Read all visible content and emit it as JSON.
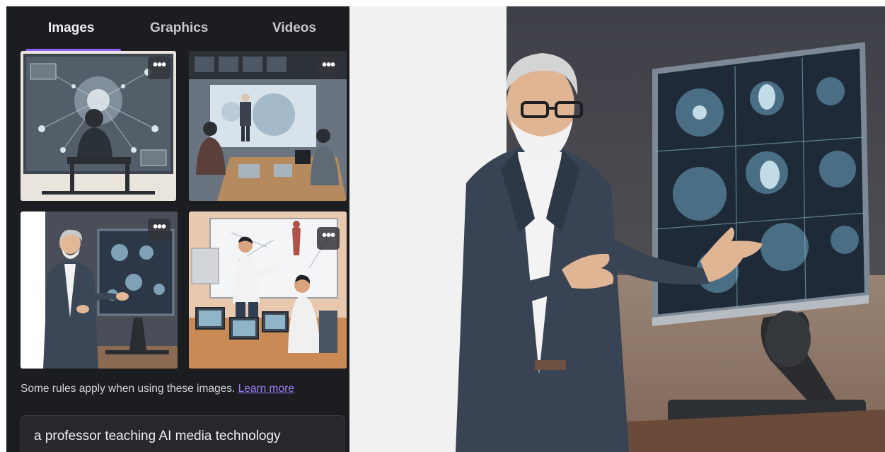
{
  "tabs": [
    {
      "label": "Images",
      "active": true
    },
    {
      "label": "Graphics",
      "active": false
    },
    {
      "label": "Videos",
      "active": false
    }
  ],
  "results": [
    {
      "name": "result-professor-network-screen",
      "more_label": "•••"
    },
    {
      "name": "result-classroom-presentation",
      "more_label": "•••"
    },
    {
      "name": "result-professor-gesturing-monitor",
      "more_label": "•••"
    },
    {
      "name": "result-lab-teaching-computers",
      "more_label": "•••"
    }
  ],
  "notice": {
    "text": "Some rules apply when using these images.",
    "link": "Learn more"
  },
  "prompt": {
    "value": "a professor teaching AI media technology"
  },
  "colors": {
    "panel_bg": "#1c1d21",
    "accent": "#8b5cf6",
    "link": "#9d7cf5"
  }
}
